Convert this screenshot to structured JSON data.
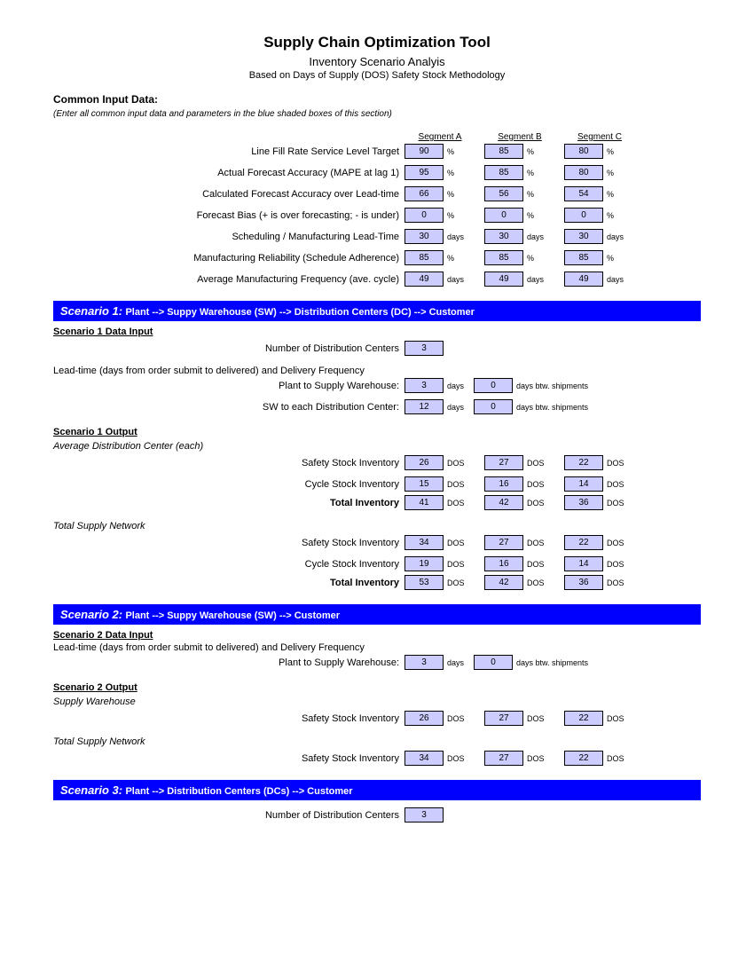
{
  "title": "Supply Chain Optimization Tool",
  "subtitle": "Inventory Scenario Analyis",
  "subtitle2": "Based on Days of Supply (DOS) Safety Stock Methodology",
  "input_section": "Common Input Data:",
  "input_instr": "(Enter all common input data and parameters in the blue shaded boxes of this section)",
  "columns": {
    "a": "Segment A",
    "b": "Segment B",
    "c": "Segment C"
  },
  "common": {
    "rows": [
      {
        "label": "Line Fill Rate Service Level Target",
        "a": "90",
        "b": "85",
        "c": "80",
        "u": "%"
      },
      {
        "label": "Actual Forecast Accuracy (MAPE at lag 1)",
        "a": "95",
        "b": "85",
        "c": "80",
        "u": "%"
      },
      {
        "label": "Calculated Forecast Accuracy over Lead-time",
        "a": "66",
        "b": "56",
        "c": "54",
        "u": "%"
      },
      {
        "label": "Forecast Bias (+ is over forecasting; - is under)",
        "a": "0",
        "b": "0",
        "c": "0",
        "u": "%"
      },
      {
        "label": "Scheduling / Manufacturing Lead-Time",
        "a": "30",
        "b": "30",
        "c": "30",
        "u": "days"
      },
      {
        "label": "Manufacturing Reliability (Schedule Adherence)",
        "a": "85",
        "b": "85",
        "c": "85",
        "u": "%"
      },
      {
        "label": "Average Manufacturing Frequency (ave. cycle)",
        "a": "49",
        "b": "49",
        "c": "49",
        "u": "days"
      }
    ]
  },
  "s1": {
    "bar_title": "Scenario 1:",
    "bar_desc": "Plant --> Suppy Warehouse (SW) --> Distribution Centers (DC) --> Customer",
    "s1_head": "Scenario 1 Data Input",
    "num_dc_label": "Number of Distribution Centers",
    "num_dc": "3",
    "lt_head": "Lead-time (days from order submit to delivered) and Delivery Frequency",
    "plant_sw": "Plant to Supply Warehouse:  ",
    "plant_sw_days": "3",
    "plant_sw_freq": "0",
    "sw_dc": "SW to each Distribution Center: ",
    "sw_dc_days": "12",
    "sw_dc_freq": "0",
    "output_head": "Scenario 1 Output",
    "dc_it": "Average Distribution Center (each)",
    "ss_label": "Safety Stock Inventory",
    "cy_label": "Cycle Stock Inventory",
    "tot_label": "Total Inventory",
    "dc": {
      "ss": {
        "a": "26",
        "b": "27",
        "c": "22"
      },
      "cy": {
        "a": "15",
        "b": "16",
        "c": "14"
      },
      "tot": {
        "a": "41",
        "b": "42",
        "c": "36"
      }
    },
    "net_it": "Total Supply Network",
    "net": {
      "ss": {
        "a": "34",
        "b": "27",
        "c": "22"
      },
      "cy": {
        "a": "19",
        "b": "16",
        "c": "14"
      },
      "tot": {
        "a": "53",
        "b": "42",
        "c": "36"
      }
    }
  },
  "s2": {
    "bar_title": "Scenario 2:",
    "bar_desc": "Plant --> Suppy Warehouse (SW) --> Customer",
    "s2_head": "Scenario 2 Data Input",
    "lt_head": "Lead-time (days from order submit to delivered) and Delivery Frequency",
    "plant_sw": "Plant to Supply Warehouse:  ",
    "plant_sw_days": "3",
    "plant_sw_freq": "0",
    "output_head": "Scenario 2 Output",
    "sw_it": "Supply Warehouse",
    "sw": {
      "ss": {
        "a": "26",
        "b": "27",
        "c": "22"
      }
    },
    "net_it": "Total Supply Network",
    "net": {
      "ss": {
        "a": "34",
        "b": "27",
        "c": "22"
      }
    }
  },
  "s3": {
    "bar_title": "Scenario 3:",
    "bar_desc": "Plant --> Distribution Centers (DCs) --> Customer",
    "num_dc_label": "Number of Distribution Centers",
    "num_dc": "3"
  },
  "unit_days": "days",
  "unit_freq": "days btw. shipments",
  "unit_dos": "DOS"
}
